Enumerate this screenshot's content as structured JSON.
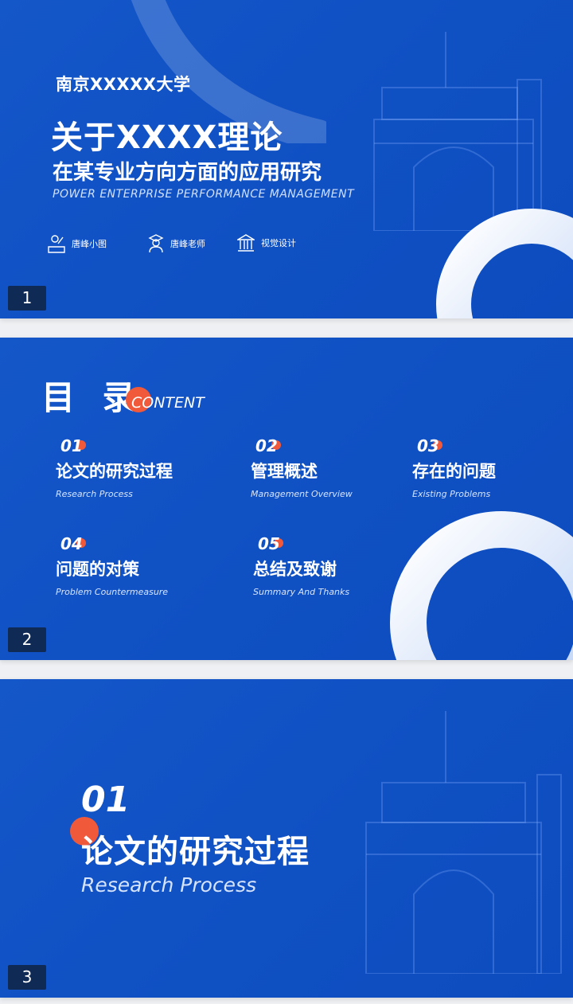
{
  "slide1": {
    "number": "1",
    "university": "南京XXXXX大学",
    "title": "关于XXXX理论",
    "subtitle": "在某专业方向方面的应用研究",
    "english": "POWER ENTERPRISE PERFORMANCE MANAGEMENT",
    "meta": [
      {
        "icon": "presenter-icon",
        "label": "唐峰小图"
      },
      {
        "icon": "teacher-icon",
        "label": "唐峰老师"
      },
      {
        "icon": "building-icon",
        "label": "视觉设计"
      }
    ]
  },
  "slide2": {
    "number": "2",
    "title": "目 录",
    "title_en": "CONTENT",
    "items": [
      {
        "num": "01",
        "cn": "论文的研究过程",
        "en": "Research Process"
      },
      {
        "num": "02",
        "cn": "管理概述",
        "en": "Management Overview"
      },
      {
        "num": "03",
        "cn": "存在的问题",
        "en": "Existing Problems"
      },
      {
        "num": "04",
        "cn": "问题的对策",
        "en": "Problem Countermeasure"
      },
      {
        "num": "05",
        "cn": "总结及致谢",
        "en": "Summary And Thanks"
      }
    ]
  },
  "slide3": {
    "number": "3",
    "section_num": "01",
    "section_cn": "论文的研究过程",
    "section_en": "Research Process"
  },
  "colors": {
    "background": "#1052c5",
    "accent": "#f05a3a",
    "number_badge": "#0f2a55"
  }
}
